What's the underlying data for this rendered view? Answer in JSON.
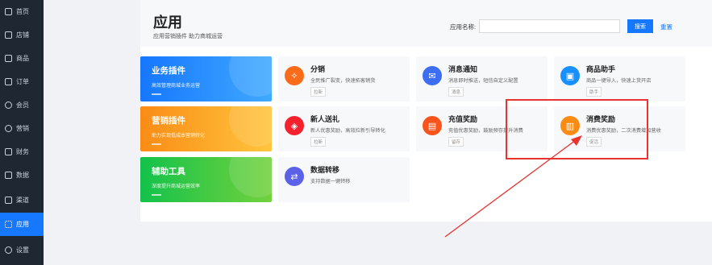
{
  "sidebar": {
    "items": [
      {
        "label": "首页",
        "icon": "home-icon"
      },
      {
        "label": "店铺",
        "icon": "shop-icon"
      },
      {
        "label": "商品",
        "icon": "goods-icon"
      },
      {
        "label": "订单",
        "icon": "order-icon"
      },
      {
        "label": "会员",
        "icon": "member-icon"
      },
      {
        "label": "营销",
        "icon": "marketing-icon"
      },
      {
        "label": "财务",
        "icon": "finance-icon"
      },
      {
        "label": "数据",
        "icon": "data-icon"
      },
      {
        "label": "渠道",
        "icon": "channel-icon"
      },
      {
        "label": "应用",
        "icon": "app-icon",
        "active": true
      },
      {
        "label": "设置",
        "icon": "settings-icon"
      }
    ]
  },
  "header": {
    "title": "应用",
    "subtitle": "应用营销插件 助力商城运营",
    "search_label": "应用名称:",
    "search_placeholder": "",
    "search_button": "搜索",
    "reset_link": "重置"
  },
  "categories": [
    {
      "title": "业务插件",
      "subtitle": "高效管理商城业务运营",
      "color": "#1677ff"
    },
    {
      "title": "营销插件",
      "subtitle": "助力实现低成本营销转化",
      "color": "#fa8c16"
    },
    {
      "title": "辅助工具",
      "subtitle": "深度提升商城运营效率",
      "color": "#13c24b"
    }
  ],
  "plugins": [
    {
      "title": "分销",
      "desc": "全民推广裂变，快速拓客销货",
      "tag": "拉新",
      "icon": "share-icon",
      "color": "#fa6b1a"
    },
    {
      "title": "消息通知",
      "desc": "消息即时推送，短信自定义配置",
      "tag": "消息",
      "icon": "message-icon",
      "color": "#3d6df2"
    },
    {
      "title": "商品助手",
      "desc": "商品一键导入，快速上货开店",
      "tag": "助手",
      "icon": "assistant-icon",
      "color": "#1890ff"
    },
    {
      "title": "新人送礼",
      "desc": "新人优惠奖励，高效拉新引导转化",
      "tag": "拉新",
      "icon": "gift-icon",
      "color": "#f5222d"
    },
    {
      "title": "充值奖励",
      "desc": "充值优惠奖励，鼓励预存提升消费",
      "tag": "留存",
      "icon": "recharge-icon",
      "color": "#fa541c"
    },
    {
      "title": "消费奖励",
      "desc": "消费优惠奖励，二次消费增加营收",
      "tag": "促活",
      "icon": "consume-reward-icon",
      "color": "#fa8c16"
    },
    {
      "title": "数据转移",
      "desc": "支持数据一键转移",
      "tag": "",
      "icon": "data-transfer-icon",
      "color": "#5b62e8"
    }
  ],
  "colors": {
    "accent": "#1677ff",
    "sidebar_bg": "#1f2733",
    "highlight": "#e8332f"
  }
}
